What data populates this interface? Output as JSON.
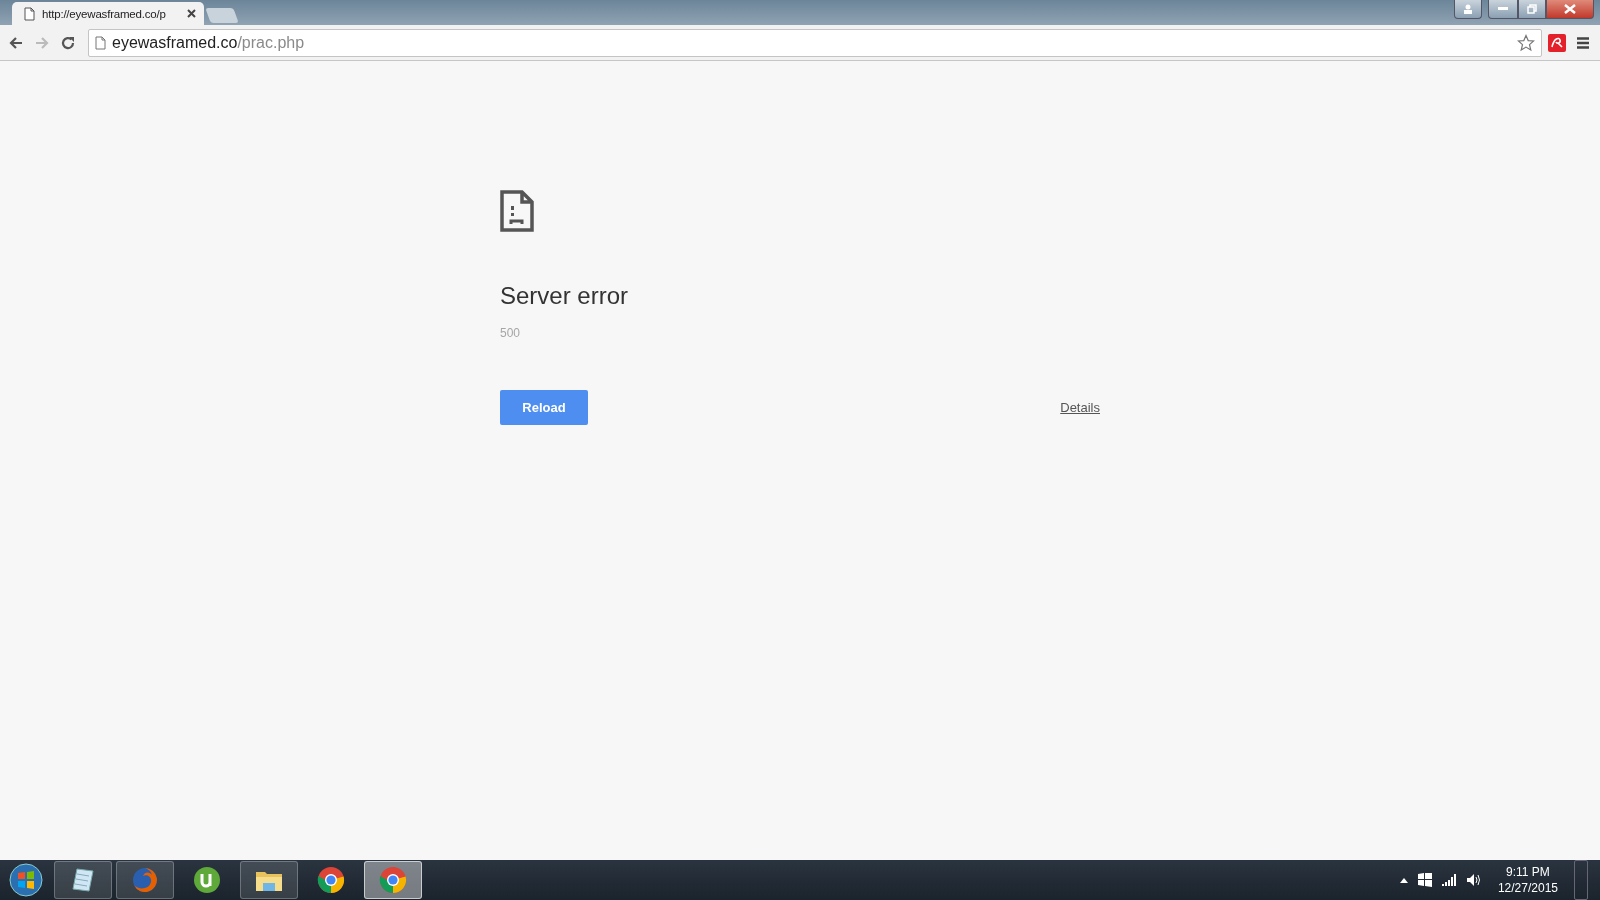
{
  "tabs": [
    {
      "title": "http://eyewasframed.co/p",
      "selected": true
    }
  ],
  "toolbar": {
    "url_host": "eyewasframed.co",
    "url_path": "/prac.php",
    "back_enabled": true,
    "forward_enabled": false
  },
  "error_page": {
    "title": "Server error",
    "code": "500",
    "reload_button": "Reload",
    "details_link": "Details"
  },
  "taskbar": {
    "apps": [
      {
        "kind": "notepad",
        "running": true,
        "selected": false
      },
      {
        "kind": "firefox",
        "running": true,
        "selected": false
      },
      {
        "kind": "utorrent",
        "running": false,
        "selected": false
      },
      {
        "kind": "explorer",
        "running": true,
        "selected": false
      },
      {
        "kind": "chrome",
        "running": false,
        "selected": false
      },
      {
        "kind": "chrome",
        "running": true,
        "selected": true
      }
    ],
    "time": "9:11 PM",
    "date": "12/27/2015"
  }
}
